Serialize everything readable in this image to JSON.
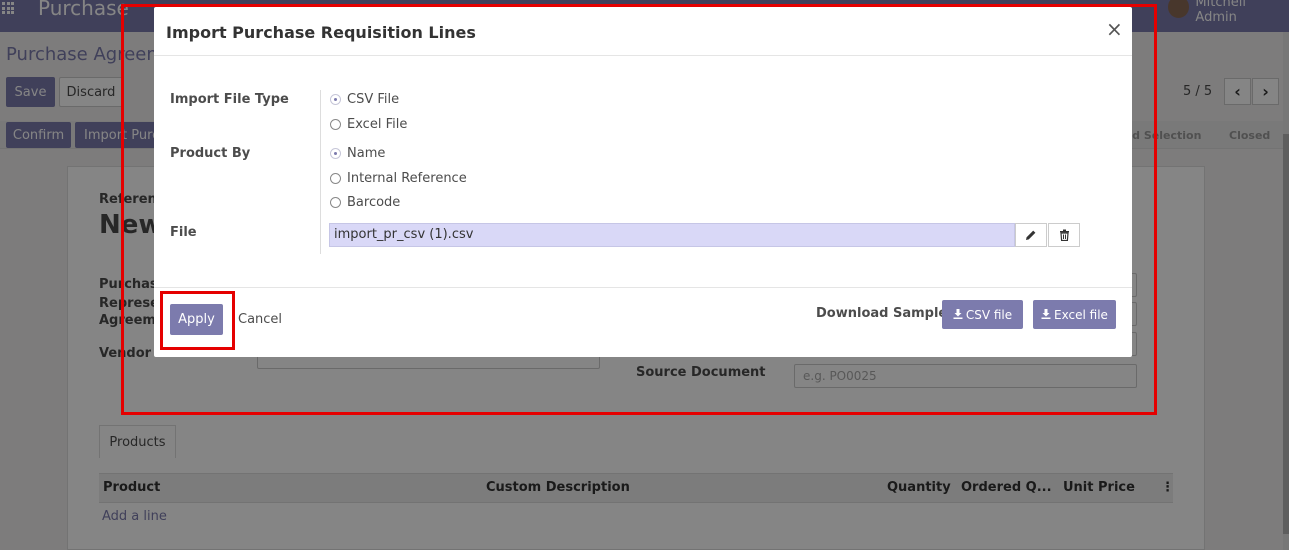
{
  "app": {
    "brand": "Purchase",
    "user_name": "Mitchell Admin"
  },
  "background": {
    "breadcrumb": "Purchase Agreements",
    "save_label": "Save",
    "discard_label": "Discard",
    "pager_text": "5 / 5",
    "confirm_label": "Confirm",
    "import_label": "Import Purchase Requisition Lines",
    "status_bid": "Bid Selection",
    "status_closed": "Closed",
    "reference_label": "Reference",
    "reference_value": "New",
    "purchase_representative_label": "Purchase Representative",
    "agreement_label": "Agreement",
    "vendor_label": "Vendor",
    "source_document_label": "Source Document",
    "source_document_placeholder": "e.g. PO0025",
    "tab_products": "Products",
    "columns": [
      "Product",
      "Custom Description",
      "Quantity",
      "Ordered Q...",
      "Unit Price"
    ],
    "add_line": "Add a line"
  },
  "modal": {
    "title": "Import Purchase Requisition Lines",
    "close": "×",
    "import_file_type_label": "Import File Type",
    "file_types": [
      {
        "label": "CSV File",
        "checked": true
      },
      {
        "label": "Excel File",
        "checked": false
      }
    ],
    "product_by_label": "Product By",
    "product_by": [
      {
        "label": "Name",
        "checked": true
      },
      {
        "label": "Internal Reference",
        "checked": false
      },
      {
        "label": "Barcode",
        "checked": false
      }
    ],
    "file_label": "File",
    "file_value": "import_pr_csv (1).csv",
    "edit_icon": "pencil-icon",
    "delete_icon": "trash-icon",
    "apply_label": "Apply",
    "cancel_label": "Cancel",
    "download_sample_label": "Download Sample:",
    "csv_button": "CSV file",
    "excel_button": "Excel file",
    "download_icon": "download-icon"
  },
  "colors": {
    "primary": "#7c7bad",
    "highlight": "#e50000",
    "file_bg": "#d9d8f7"
  }
}
